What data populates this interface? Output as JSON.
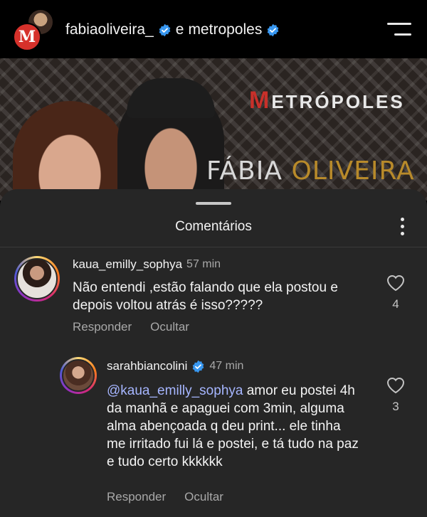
{
  "header": {
    "account1": "fabiaoliveira_",
    "connector": "e",
    "account2": "metropoles"
  },
  "video": {
    "logo_initial": "M",
    "logo_rest": "ETRÓPOLES",
    "overlay_word1": "FÁBIA",
    "overlay_word2": "OLIVEIRA"
  },
  "sheet": {
    "title": "Comentários"
  },
  "comments": [
    {
      "username": "kaua_emilly_sophya",
      "time": "57 min",
      "text": "Não entendi ,estão falando que ela postou e depois voltou atrás é isso?????",
      "reply_label": "Responder",
      "hide_label": "Ocultar",
      "likes": "4"
    },
    {
      "username": "sarahbiancolini",
      "verified": true,
      "time": "47 min",
      "mention": "@kaua_emilly_sophya",
      "text": " amor eu postei 4h da manhã e apaguei com 3min, alguma alma abençoada q deu print... ele tinha me irritado fui lá e postei, e tá tudo na paz e tudo certo kkkkkk",
      "reply_label": "Responder",
      "hide_label": "Ocultar",
      "likes": "3"
    }
  ],
  "colors": {
    "background": "#000000",
    "sheet": "#262626",
    "mention": "#a6b6ff",
    "verified": "#3897f0"
  }
}
